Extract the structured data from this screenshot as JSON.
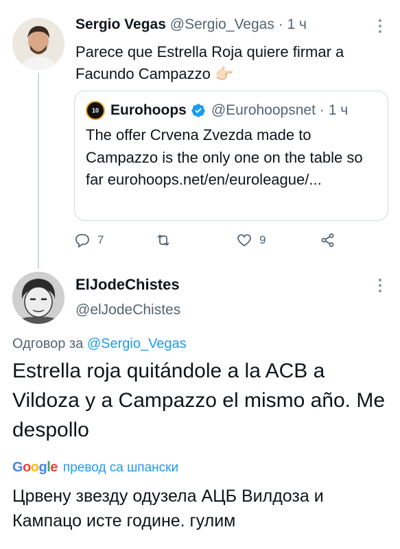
{
  "parent_tweet": {
    "name": "Sergio Vegas",
    "handle": "@Sergio_Vegas",
    "time": "· 1 ч",
    "text": "Parece que Estrella Roja quiere firmar a Facundo Campazzo 👉🏻"
  },
  "quoted_tweet": {
    "logo_text": "10",
    "name": "Eurohoops",
    "handle": "@Eurohoopsnet",
    "time": "· 1 ч",
    "text": "The offer Crvena Zvezda made to Campazzo is the only one on the table so far eurohoops.net/en/euroleague/..."
  },
  "actions": {
    "reply_count": "7",
    "retweet_count": "",
    "like_count": "9"
  },
  "reply_tweet": {
    "name": "ElJodeChistes",
    "handle": "@elJodeChistes",
    "reply_prefix": "Одговор за",
    "reply_to": "@Sergio_Vegas",
    "text": "Estrella roja quitándole a la ACB a Vildoza y a Campazzo el mismo año. Me despollo",
    "google_letters": [
      "G",
      "o",
      "o",
      "g",
      "l",
      "e"
    ],
    "translate_label": "превод са шпански",
    "translated_text": "Црвену звезду одузела АЦБ Вилдоза и Кампацо исте године. гулим"
  },
  "colors": {
    "link": "#1d9bf0",
    "secondary_text": "#536471",
    "verified": "#1d9bf0",
    "border": "#cfd9de"
  }
}
